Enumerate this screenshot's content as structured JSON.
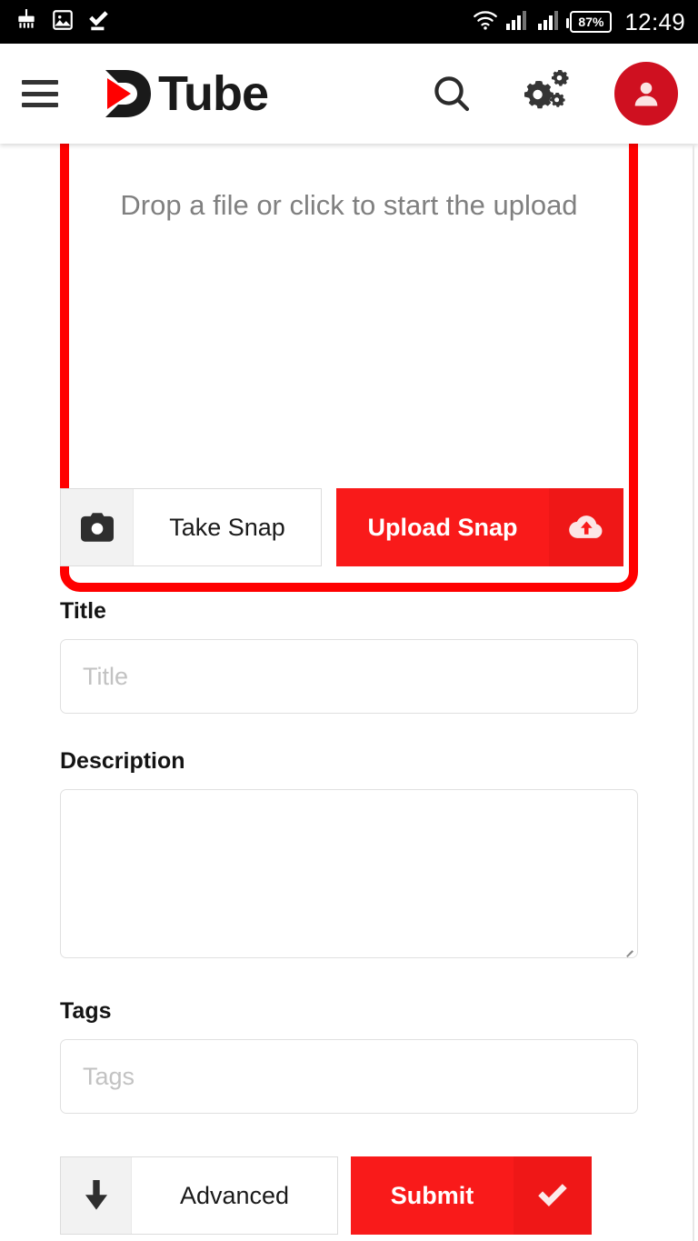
{
  "status_bar": {
    "time": "12:49",
    "battery_percent": "87%",
    "left_icons": [
      "brush-icon",
      "image-icon",
      "check-underline-icon"
    ],
    "right_icons": [
      "wifi-icon",
      "signal-bars-sim1-icon",
      "signal-bars-sim2-icon",
      "battery-icon"
    ],
    "background_color": "#000000",
    "foreground_color": "#ffffff"
  },
  "header": {
    "menu_icon": "hamburger-menu-icon",
    "brand_d": "D",
    "brand_word": "Tube",
    "search_icon": "search-icon",
    "settings_icon": "cogs-icon",
    "avatar_icon": "user-avatar-icon",
    "brand_accent_color": "#ff0000",
    "avatar_background_color": "#cf1020"
  },
  "upload": {
    "dropzone_text": "Drop a file or click to start the upload",
    "dropzone_border_color": "#ff0000",
    "take_snap_label": "Take Snap",
    "take_snap_icon": "camera-icon",
    "upload_snap_label": "Upload Snap",
    "upload_snap_icon": "cloud-upload-icon",
    "primary_button_color": "#f91a1a"
  },
  "form": {
    "title_label": "Title",
    "title_placeholder": "Title",
    "title_value": "",
    "description_label": "Description",
    "description_placeholder": "",
    "description_value": "",
    "tags_label": "Tags",
    "tags_placeholder": "Tags",
    "tags_value": ""
  },
  "actions": {
    "advanced_label": "Advanced",
    "advanced_icon": "arrow-down-icon",
    "submit_label": "Submit",
    "submit_icon": "check-icon"
  }
}
